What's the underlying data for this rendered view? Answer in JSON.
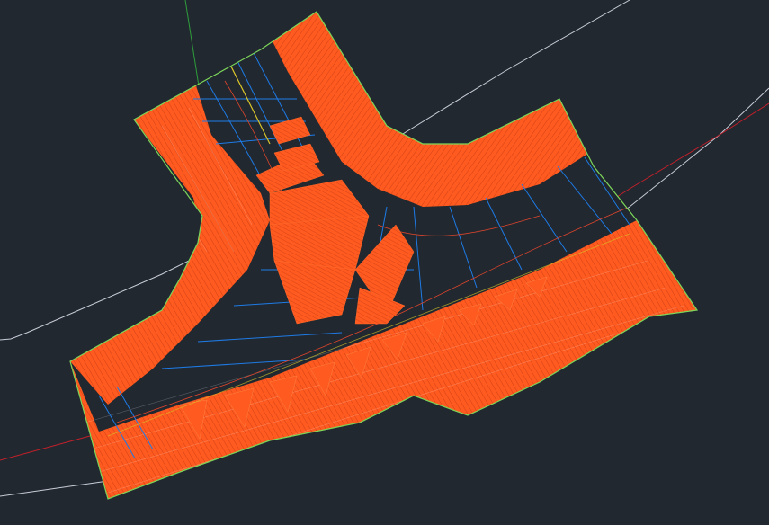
{
  "app": {
    "title": ""
  },
  "viewport": {
    "background": "#212830",
    "colors": {
      "hatch_orange": "#ff5a1f",
      "hatch_dark": "#d9461a",
      "boundary_green": "#7cd65a",
      "grid_blue": "#1e7be6",
      "grid_light": "#9fa8c7",
      "road_white": "#c8ccd6",
      "road_red": "#c2202a",
      "axis_green": "#2e9d3a",
      "center_yellow": "#d9c52a"
    },
    "icons": []
  }
}
